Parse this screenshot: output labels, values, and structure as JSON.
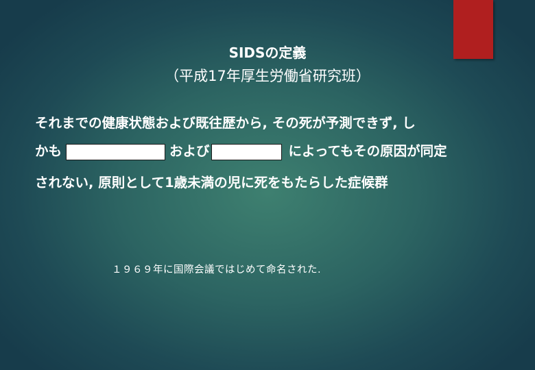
{
  "title": {
    "main": "SIDSの定義",
    "sub": "（平成17年厚生労働省研究班）"
  },
  "definition": {
    "line1": "それまでの健康状態および既往歴から, その死が予測できず, し",
    "line2_start": "かも",
    "line2_middle": "および",
    "line2_end": "によってもその原因が同定",
    "line3": "されない, 原則として1歳未満の児に死をもたらした症候群"
  },
  "footnote": "１９６９年に国際会議ではじめて命名された.",
  "colors": {
    "accent_tab": "#b01f1f",
    "background_center": "#3e8070",
    "background_edge": "#173c4b",
    "text": "#ffffff"
  }
}
